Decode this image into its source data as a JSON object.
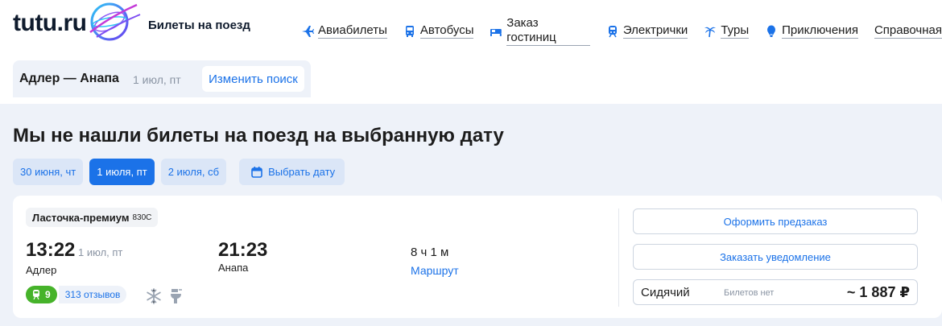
{
  "header": {
    "logo_text": "tutu.ru",
    "logo_caption": "Билеты на поезд",
    "nav": [
      {
        "label": "Авиабилеты",
        "icon": "plane-icon"
      },
      {
        "label": "Автобусы",
        "icon": "bus-icon"
      },
      {
        "label": "Заказ гостиниц",
        "icon": "bed-icon"
      },
      {
        "label": "Электрички",
        "icon": "train-icon"
      },
      {
        "label": "Туры",
        "icon": "palm-icon"
      },
      {
        "label": "Приключения",
        "icon": "balloon-icon"
      },
      {
        "label": "Справочная",
        "icon": ""
      }
    ]
  },
  "search": {
    "route": "Адлер — Анапа",
    "date": "1 июл, пт",
    "change_label": "Изменить поиск"
  },
  "main": {
    "title": "Мы не нашли билеты на поезд на выбранную дату",
    "dates": [
      {
        "label": "30 июня, чт",
        "active": false
      },
      {
        "label": "1 июля, пт",
        "active": true
      },
      {
        "label": "2 июля, сб",
        "active": false
      }
    ],
    "pick_date_label": "Выбрать дату"
  },
  "train": {
    "name": "Ласточка-премиум",
    "number": "830С",
    "departure_time": "13:22",
    "departure_date": "1 июл, пт",
    "departure_city": "Адлер",
    "arrival_time": "21:23",
    "arrival_city": "Анапа",
    "duration": "8 ч 1 м",
    "route_link": "Маршрут",
    "rating": "9",
    "reviews": "313 отзывов",
    "features": [
      "snowflake-icon",
      "toilet-icon"
    ],
    "preorder_label": "Оформить предзаказ",
    "notify_label": "Заказать уведомление",
    "seat_type": "Сидячий",
    "seat_status": "Билетов нет",
    "seat_price": "~ 1 887 ₽"
  },
  "colors": {
    "accent": "#1b72e8",
    "background": "#eef2f9",
    "rating_green": "#46b32a"
  }
}
